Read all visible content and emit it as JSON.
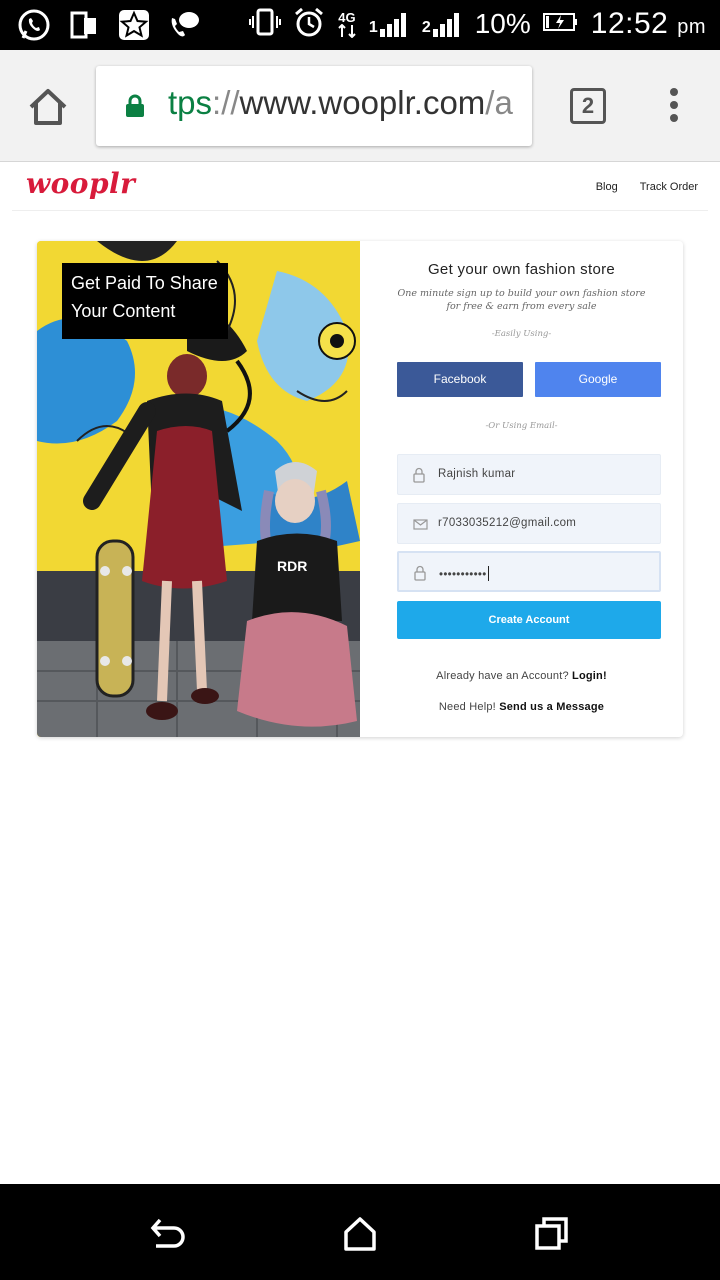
{
  "status_bar": {
    "network_label": "4G",
    "sim1": "1",
    "sim2": "2",
    "battery": "10%",
    "time": "12:52",
    "ampm": "pm"
  },
  "browser": {
    "url_scheme": "tps",
    "url_sep": "://",
    "url_host": "www.wooplr.com",
    "url_rest": "/a",
    "tab_count": "2"
  },
  "site": {
    "logo": "wooplr",
    "nav": [
      "Blog",
      "Track Order"
    ]
  },
  "card": {
    "banner": "Get Paid To Share Your Content",
    "title": "Get your own fashion store",
    "subtitle": "One minute sign up to build your own fashion store for free & earn from every sale",
    "easily_using": "-Easily Using-",
    "facebook_label": "Facebook",
    "google_label": "Google",
    "or_using_email": "-Or Using Email-",
    "name_value": "Rajnish kumar",
    "email_value": "r7033035212@gmail.com",
    "password_value": "•••••••••••",
    "create_label": "Create Account",
    "already_text": "Already have an Account? ",
    "login_link": "Login!",
    "help_text": "Need Help! ",
    "message_link": "Send us a Message"
  },
  "colors": {
    "brand": "#d81b3b",
    "facebook": "#3b5998",
    "google": "#4f84ee",
    "create": "#1ea9ea"
  }
}
